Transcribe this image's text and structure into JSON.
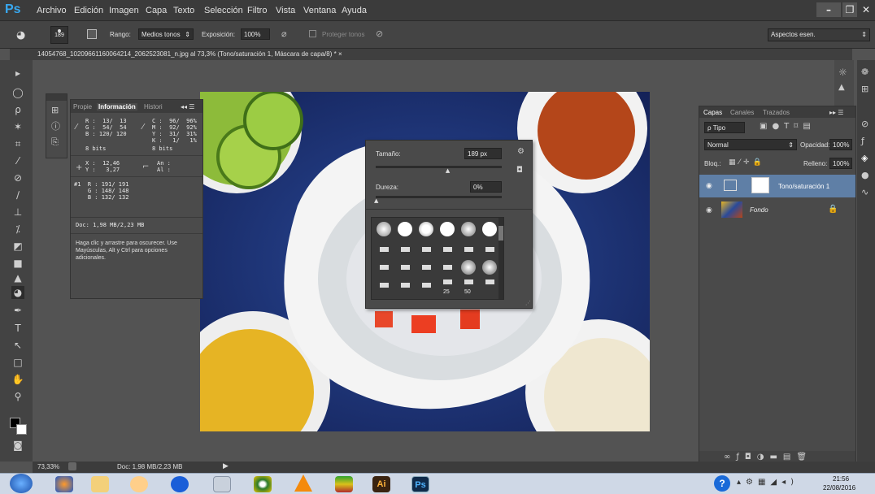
{
  "app": {
    "logo": "Ps",
    "menus": [
      "Archivo",
      "Edición",
      "Imagen",
      "Capa",
      "Texto",
      "Selección",
      "Filtro",
      "Vista",
      "Ventana",
      "Ayuda"
    ]
  },
  "options": {
    "brush_size": "189",
    "range_label": "Rango:",
    "range_value": "Medios tonos",
    "exposure_label": "Exposición:",
    "exposure_value": "100%",
    "protect_label": "Proteger tonos",
    "workspace": "Aspectos esen."
  },
  "document": {
    "tab_title": "14054768_10209661160064214_2062523081_n.jpg al 73,3% (Tono/saturación 1, Máscara de capa/8) *"
  },
  "info_panel": {
    "tabs": [
      "Propie",
      "Información",
      "Histori"
    ],
    "rgb_values": "R :  13/  13\nG :  54/  54\nB : 120/ 120",
    "cmyk_values": "C :  96/  96%\nM :  92/  92%\nY :  31/  31%\nK :   1/   1%",
    "bits_left": "8 bits",
    "bits_right": "8 bits",
    "xy_values": "X :  12,46\nY :   3,27",
    "size_values": "An :\nAl :",
    "sample_values": "#1  R : 191/ 191\n    G : 148/ 148\n    B : 132/ 132",
    "doc_size": "Doc: 1,98 MB/2,23 MB",
    "help_text": "Haga clic y arrastre para oscurecer. Use Mayúsculas, Alt y Ctrl para opciones adicionales."
  },
  "brush_picker": {
    "size_label": "Tamaño:",
    "size_value": "189 px",
    "size_slider": 0.58,
    "hardness_label": "Dureza:",
    "hardness_value": "0%",
    "hardness_slider": 0.0,
    "preset_labels": [
      "25",
      "50"
    ]
  },
  "layers_panel": {
    "tabs": [
      "Capas",
      "Canales",
      "Trazados"
    ],
    "filter_label": "ρ Tipo",
    "blend_mode": "Normal",
    "opacity_label": "Opacidad:",
    "opacity_value": "100%",
    "lock_label": "Bloq.:",
    "fill_label": "Relleno:",
    "fill_value": "100%",
    "layers": [
      {
        "name": "Tono/saturación 1",
        "selected": true
      },
      {
        "name": "Fondo",
        "selected": false
      }
    ]
  },
  "status": {
    "zoom": "73,33%",
    "doc": "Doc: 1,98 MB/2,23 MB"
  },
  "taskbar": {
    "time": "21:56",
    "date": "22/08/2016"
  }
}
